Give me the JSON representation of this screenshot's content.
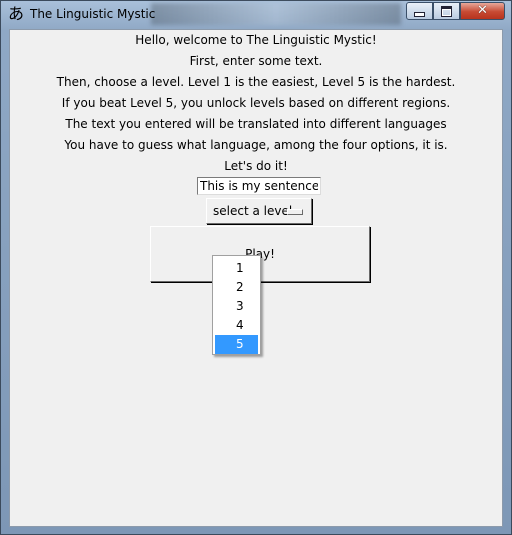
{
  "window": {
    "title": "The Linguistic Mystic",
    "icon": "hiragana-a-icon",
    "icon_glyph": "あ",
    "controls": {
      "minimize": "minimize-icon",
      "maximize": "maximize-icon",
      "close": "close-icon"
    }
  },
  "intro": {
    "lines": [
      "Hello, welcome to The Linguistic Mystic!",
      "First, enter some text.",
      "Then, choose a level. Level  1 is the easiest, Level 5 is the hardest.",
      "If you beat Level 5, you unlock levels based on different regions.",
      "The text you entered will be translated into different languages",
      "You have to guess what language, among the four options, it is.",
      "Let's do it!"
    ]
  },
  "text_entry": {
    "value": "This is my sentence"
  },
  "level_select": {
    "label": "select a level",
    "options": [
      "1",
      "2",
      "3",
      "4",
      "5"
    ],
    "highlighted": "5"
  },
  "play_button": {
    "label": "Play!"
  },
  "colors": {
    "highlight": "#3399ff",
    "client_bg": "#f0f0f0",
    "close_button": "#c74a33"
  }
}
